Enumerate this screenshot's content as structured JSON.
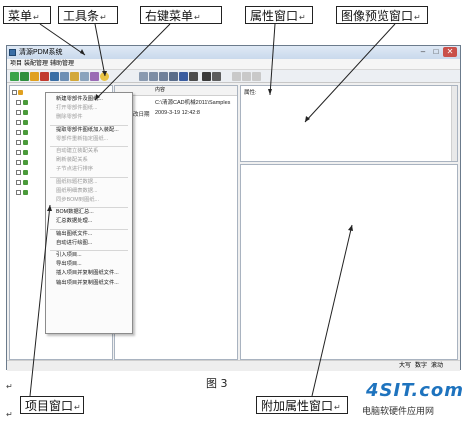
{
  "callouts": {
    "menu": "菜单",
    "toolbar": "工具条",
    "context_menu": "右键菜单",
    "properties_window": "属性窗口",
    "image_preview_window": "图像预览窗口",
    "project_window": "项目窗口",
    "extra_properties_window": "附加属性窗口",
    "mark": "↵"
  },
  "figure_caption": "图 3",
  "watermark": {
    "brand": "4SIT.com",
    "subtitle": "电脑软硬件应用网"
  },
  "window": {
    "title": "清源PDM系统",
    "menu": [
      "项目",
      "装配管理",
      "辅助管理"
    ]
  },
  "list_pane": {
    "header": "内容",
    "rows": [
      {
        "label": "",
        "value": "C:\\清源CAD机械2011\\Samples"
      },
      {
        "label": "改日期",
        "value": "2009-3-19 12:42:8"
      }
    ]
  },
  "properties_pane": {
    "label": "属性:"
  },
  "context_menu": {
    "items": [
      {
        "label": "新建零部件及图纸...",
        "disabled": false
      },
      {
        "label": "打开零部件图纸...",
        "disabled": true
      },
      {
        "label": "删除零部件",
        "disabled": true
      },
      {
        "sep": true
      },
      {
        "label": "提取零部件图纸加入装配...",
        "disabled": false
      },
      {
        "label": "零部件重新指定图纸...",
        "disabled": true
      },
      {
        "sep": true
      },
      {
        "label": "自动建立装配关系",
        "disabled": true
      },
      {
        "label": "刷新装配关系",
        "disabled": true
      },
      {
        "label": "子节点进行排序",
        "disabled": true
      },
      {
        "sep": true
      },
      {
        "label": "图纸标题栏数据...",
        "disabled": true
      },
      {
        "label": "图纸明细表数据...",
        "disabled": true
      },
      {
        "label": "同步BOM到图纸...",
        "disabled": true
      },
      {
        "sep": true
      },
      {
        "label": "BOM数据汇总...",
        "disabled": false
      },
      {
        "label": "汇总数据处理...",
        "disabled": false
      },
      {
        "sep": true
      },
      {
        "label": "输出图纸文件...",
        "disabled": false
      },
      {
        "label": "自动进行绘图...",
        "disabled": false
      },
      {
        "sep": true
      },
      {
        "label": "引入项目...",
        "disabled": false
      },
      {
        "label": "导出项目...",
        "disabled": false
      },
      {
        "label": "插入项目并复制图纸文件...",
        "disabled": false
      },
      {
        "label": "输出项目并复制图纸文件...",
        "disabled": false
      }
    ]
  },
  "statusbar": {
    "caps": "大写",
    "num": "数字",
    "scroll": "滚动"
  }
}
